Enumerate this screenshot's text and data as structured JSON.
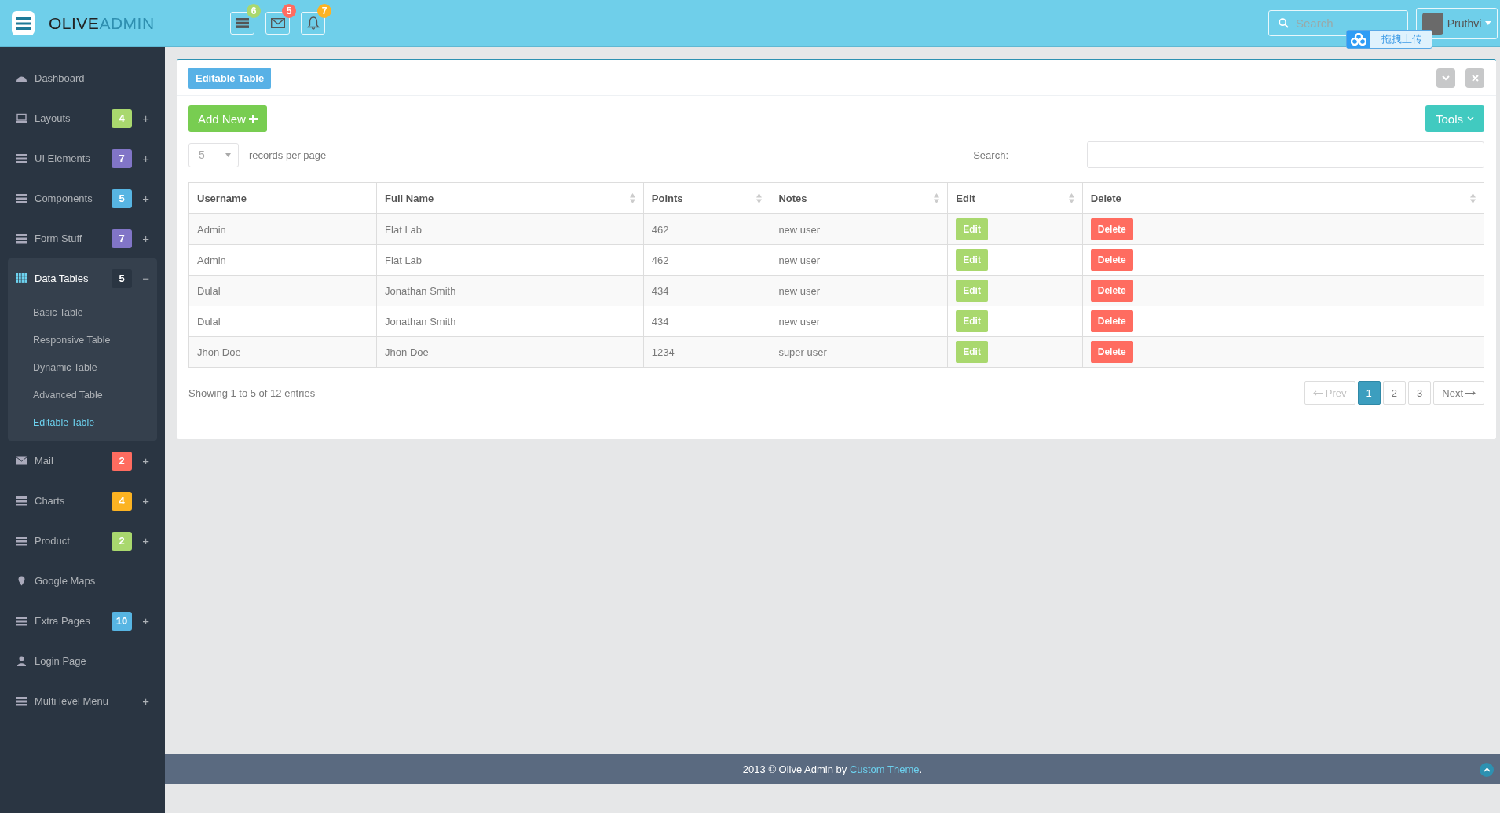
{
  "brand": {
    "first": "OLIVE",
    "second": "ADMIN"
  },
  "top_icons": [
    {
      "badge": "6",
      "color": "#a9d86e"
    },
    {
      "badge": "5",
      "color": "#ff6c60"
    },
    {
      "badge": "7",
      "color": "#fcb322"
    }
  ],
  "search": {
    "placeholder": "Search"
  },
  "upload_widget": {
    "label": "拖拽上传"
  },
  "user": {
    "name": "Pruthvi"
  },
  "sidebar": {
    "items": [
      {
        "label": "Dashboard",
        "expanded": false,
        "selected": false
      },
      {
        "label": "Layouts",
        "badge": "4",
        "color": "#a9d86e",
        "toggle": "+",
        "expanded": false,
        "selected": false
      },
      {
        "label": "UI Elements",
        "badge": "7",
        "color": "#8175c7",
        "toggle": "+",
        "expanded": false,
        "selected": false
      },
      {
        "label": "Components",
        "badge": "5",
        "color": "#57b5e3",
        "toggle": "+",
        "expanded": false,
        "selected": false
      },
      {
        "label": "Form Stuff",
        "badge": "7",
        "color": "#8175c7",
        "toggle": "+",
        "expanded": false,
        "selected": false
      },
      {
        "label": "Data Tables",
        "badge": "5",
        "color": "#2a3542",
        "toggle": "−",
        "expanded": true,
        "selected": true,
        "children": [
          {
            "label": "Basic Table",
            "selected": false
          },
          {
            "label": "Responsive Table",
            "selected": false
          },
          {
            "label": "Dynamic Table",
            "selected": false
          },
          {
            "label": "Advanced Table",
            "selected": false
          },
          {
            "label": "Editable Table",
            "selected": true
          }
        ]
      },
      {
        "label": "Mail",
        "badge": "2",
        "color": "#ff6c60",
        "toggle": "+",
        "expanded": false,
        "selected": false
      },
      {
        "label": "Charts",
        "badge": "4",
        "color": "#fcb322",
        "toggle": "+",
        "expanded": false,
        "selected": false
      },
      {
        "label": "Product",
        "badge": "2",
        "color": "#a9d86e",
        "toggle": "+",
        "expanded": false,
        "selected": false
      },
      {
        "label": "Google Maps",
        "expanded": false,
        "selected": false
      },
      {
        "label": "Extra Pages",
        "badge": "10",
        "color": "#57b5e3",
        "toggle": "+",
        "expanded": false,
        "selected": false
      },
      {
        "label": "Login Page",
        "expanded": false,
        "selected": false
      },
      {
        "label": "Multi level Menu",
        "toggle": "+",
        "expanded": false,
        "selected": false
      }
    ]
  },
  "panel": {
    "title": "Editable Table",
    "add_button": "Add New",
    "tools_button": "Tools",
    "page_size": {
      "value": "5",
      "label": "records per page"
    },
    "search_label": "Search:",
    "table": {
      "columns": [
        {
          "label": "Username",
          "sortable": false
        },
        {
          "label": "Full Name",
          "sortable": true
        },
        {
          "label": "Points",
          "sortable": true
        },
        {
          "label": "Notes",
          "sortable": true
        },
        {
          "label": "Edit",
          "sortable": true
        },
        {
          "label": "Delete",
          "sortable": true
        }
      ],
      "rows": [
        {
          "username": "Admin",
          "full_name": "Flat Lab",
          "points": "462",
          "notes": "new user",
          "edit": "Edit",
          "delete": "Delete"
        },
        {
          "username": "Admin",
          "full_name": "Flat Lab",
          "points": "462",
          "notes": "new user",
          "edit": "Edit",
          "delete": "Delete"
        },
        {
          "username": "Dulal",
          "full_name": "Jonathan Smith",
          "points": "434",
          "notes": "new user",
          "edit": "Edit",
          "delete": "Delete"
        },
        {
          "username": "Dulal",
          "full_name": "Jonathan Smith",
          "points": "434",
          "notes": "new user",
          "edit": "Edit",
          "delete": "Delete"
        },
        {
          "username": "Jhon Doe",
          "full_name": "Jhon Doe",
          "points": "1234",
          "notes": "super user",
          "edit": "Edit",
          "delete": "Delete"
        }
      ]
    },
    "info": "Showing 1 to 5 of 12 entries",
    "pagination": {
      "prev": {
        "label": "Prev",
        "disabled": true
      },
      "pages": [
        {
          "label": "1",
          "selected": true
        },
        {
          "label": "2",
          "selected": false
        },
        {
          "label": "3",
          "selected": false
        }
      ],
      "next": {
        "label": "Next",
        "disabled": false
      }
    }
  },
  "footer": {
    "text": "2013 © Olive Admin by ",
    "link": "Custom Theme",
    "end": "."
  }
}
